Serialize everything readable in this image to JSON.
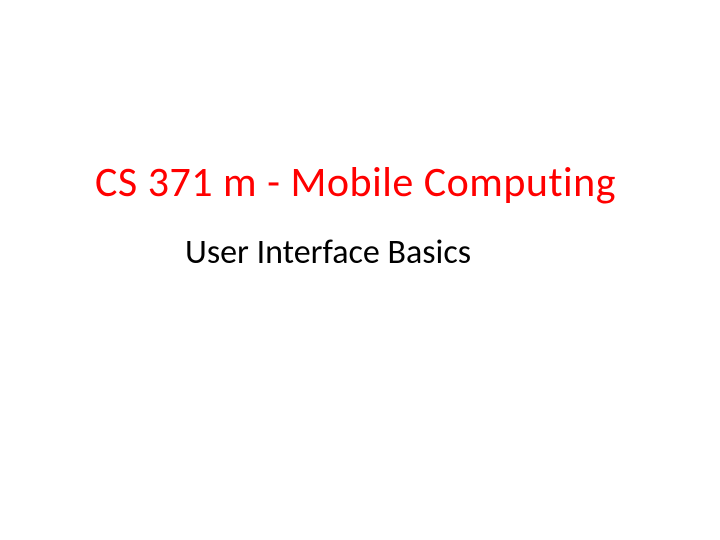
{
  "slide": {
    "title": "CS 371 m - Mobile Computing",
    "subtitle": "User Interface Basics"
  },
  "colors": {
    "title_color": "#ff0000",
    "subtitle_color": "#000000",
    "background": "#ffffff"
  }
}
